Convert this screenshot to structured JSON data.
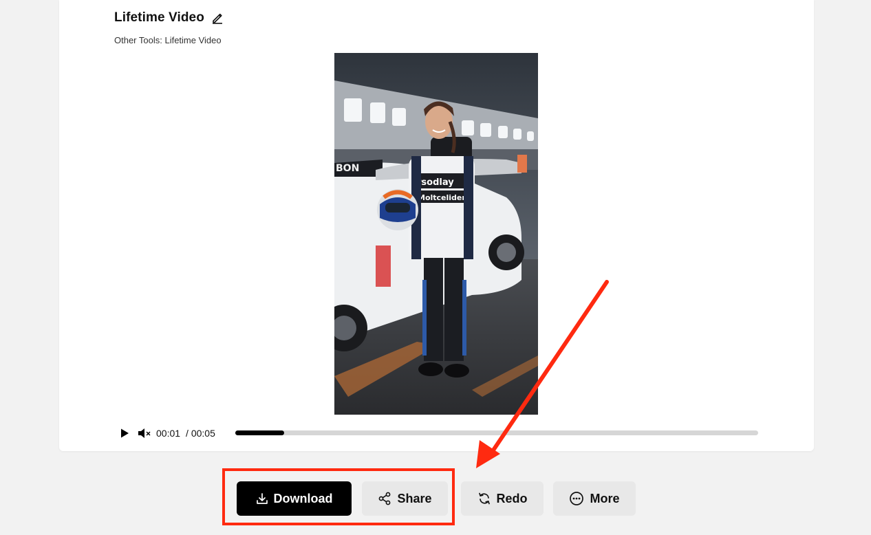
{
  "project": {
    "title": "Lifetime Video",
    "subtitle": "Other Tools: Lifetime Video"
  },
  "player": {
    "current_time": "00:01",
    "duration": "/ 00:05",
    "progress_fraction": 0.094,
    "muted": true
  },
  "actions": {
    "download_label": "Download",
    "share_label": "Share",
    "redo_label": "Redo",
    "more_label": "More"
  },
  "icons": {
    "edit": "pencil-icon",
    "play": "play-icon",
    "mute": "volume-muted-icon",
    "download": "download-icon",
    "share": "share-icon",
    "redo": "redo-icon",
    "more": "more-icon"
  },
  "annotation": {
    "highlight_color": "#ff2a10"
  }
}
